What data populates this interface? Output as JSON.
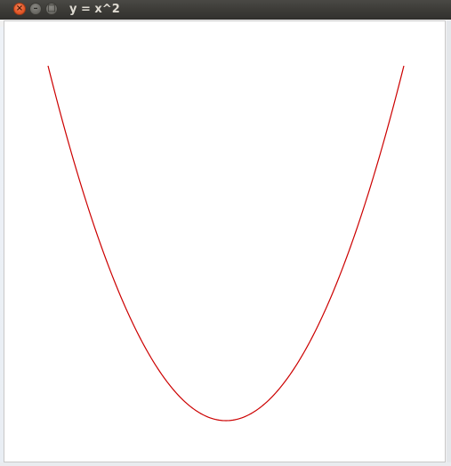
{
  "window": {
    "title": "y = x^2",
    "controls": {
      "close_icon": "close-icon",
      "minimize_icon": "minimize-icon",
      "maximize_icon": "maximize-icon"
    }
  },
  "plot": {
    "curve_color": "#cc0000",
    "background_color": "#ffffff"
  },
  "chart_data": {
    "type": "line",
    "title": "y = x^2",
    "xlabel": "",
    "ylabel": "",
    "xlim": [
      -2,
      2
    ],
    "ylim": [
      0,
      4
    ],
    "grid": false,
    "series": [
      {
        "x": [
          -2,
          -1.5,
          -1,
          -0.5,
          0,
          0.5,
          1,
          1.5,
          2
        ],
        "y": [
          4,
          2.25,
          1,
          0.25,
          0,
          0.25,
          1,
          2.25,
          4
        ]
      }
    ]
  }
}
